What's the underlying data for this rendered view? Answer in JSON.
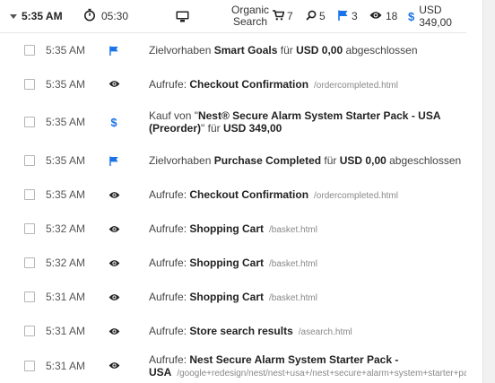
{
  "header": {
    "time": "5:35 AM",
    "duration": "05:30",
    "source_line1": "Organic",
    "source_line2": "Search",
    "cart_count": "7",
    "search_count": "5",
    "goals_count": "3",
    "views_count": "18",
    "revenue": "USD 349,00"
  },
  "rows": [
    {
      "time": "5:35 AM",
      "icon": "flag-icon",
      "type": "goal",
      "prefix": "Zielvorhaben ",
      "name": "Smart Goals",
      "mid": " für ",
      "value": "USD 0,00",
      "suffix": " abgeschlossen"
    },
    {
      "time": "5:35 AM",
      "icon": "eye-icon",
      "type": "view",
      "prefix": "Aufrufe: ",
      "name": "Checkout Confirmation",
      "url": "/ordercompleted.html"
    },
    {
      "time": "5:35 AM",
      "icon": "dollar-icon",
      "type": "purchase",
      "line1_prefix": "Kauf von \"",
      "line1_bold": "Nest® Secure Alarm System Starter Pack - USA",
      "line2_bold": "(Preorder)",
      "line2_mid": "\" für ",
      "value": "USD 349,00"
    },
    {
      "time": "5:35 AM",
      "icon": "flag-icon",
      "type": "goal",
      "prefix": "Zielvorhaben ",
      "name": "Purchase Completed",
      "mid": " für ",
      "value": "USD 0,00",
      "suffix": " abgeschlossen"
    },
    {
      "time": "5:35 AM",
      "icon": "eye-icon",
      "type": "view",
      "prefix": "Aufrufe: ",
      "name": "Checkout Confirmation",
      "url": "/ordercompleted.html"
    },
    {
      "time": "5:32 AM",
      "icon": "eye-icon",
      "type": "view",
      "prefix": "Aufrufe: ",
      "name": "Shopping Cart",
      "url": "/basket.html"
    },
    {
      "time": "5:32 AM",
      "icon": "eye-icon",
      "type": "view",
      "prefix": "Aufrufe: ",
      "name": "Shopping Cart",
      "url": "/basket.html"
    },
    {
      "time": "5:31 AM",
      "icon": "eye-icon",
      "type": "view",
      "prefix": "Aufrufe: ",
      "name": "Shopping Cart",
      "url": "/basket.html"
    },
    {
      "time": "5:31 AM",
      "icon": "eye-icon",
      "type": "view",
      "prefix": "Aufrufe: ",
      "name": "Store search results",
      "url": "/asearch.html"
    },
    {
      "time": "5:31 AM",
      "icon": "eye-icon",
      "type": "view2",
      "prefix": "Aufrufe: ",
      "name_line1": "Nest Secure Alarm System Starter Pack -",
      "name_line2": "USA",
      "url": "/google+redesign/nest/nest+usa+/nest+secure+alarm+system+starter+pack"
    }
  ],
  "colors": {
    "accent": "#1a73e8",
    "icon_dark": "#222222"
  }
}
